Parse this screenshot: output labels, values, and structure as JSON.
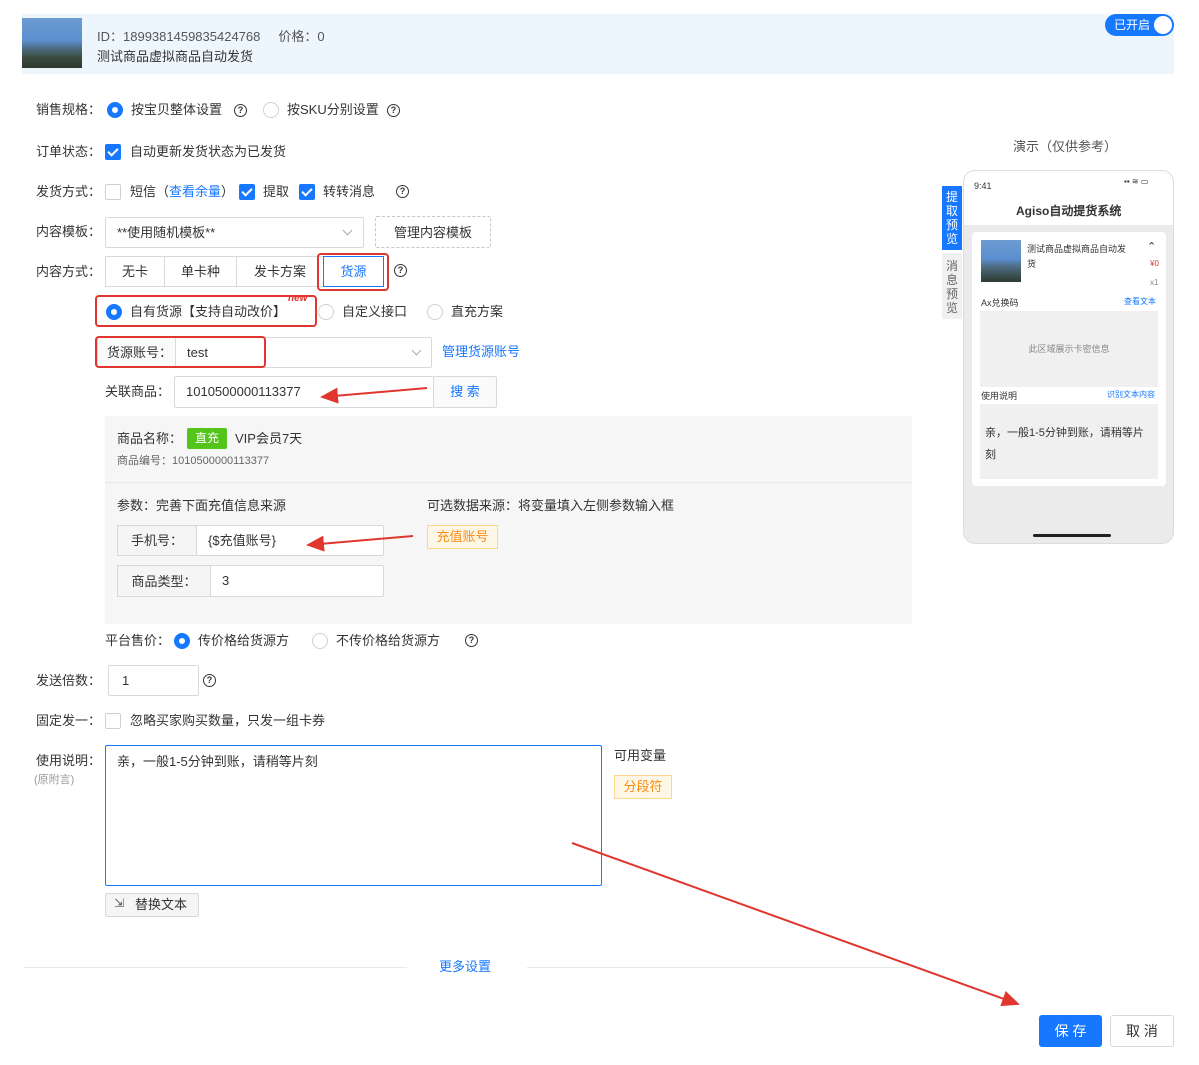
{
  "header": {
    "id_label": "ID：1899381459835424768",
    "price_label": "价格：0",
    "title": "测试商品虚拟商品自动发货",
    "status_toggle": "已开启"
  },
  "form": {
    "sales_spec": {
      "label": "销售规格：",
      "opt1": "按宝贝整体设置",
      "opt2": "按SKU分别设置"
    },
    "order_status": {
      "label": "订单状态：",
      "opt": "自动更新发货状态为已发货"
    },
    "ship_method": {
      "label": "发货方式：",
      "sms": "短信（",
      "check_balance": "查看余量",
      "sms_end": "）",
      "pickup": "提取",
      "forward": "转转消息"
    },
    "template": {
      "label": "内容模板：",
      "value": "**使用随机模板**",
      "manage": "管理内容模板"
    },
    "content_mode": {
      "label": "内容方式：",
      "tabs": [
        "无卡",
        "单卡种",
        "发卡方案",
        "货源"
      ]
    },
    "source_type": {
      "opt1": "自有货源【支持自动改价】",
      "new_badge": "new",
      "opt2": "自定义接口",
      "opt3": "直充方案"
    },
    "source_account": {
      "label": "货源账号：",
      "value": "test",
      "manage": "管理货源账号"
    },
    "related_product": {
      "label": "关联商品：",
      "value": "1010500000113377",
      "search": "搜 索"
    },
    "product_info": {
      "name_label": "商品名称：",
      "badge": "直充",
      "name": "VIP会员7天",
      "code": "商品编号：1010500000113377"
    },
    "params": {
      "title": "参数：完善下面充值信息来源",
      "source_hint": "可选数据来源：将变量填入左侧参数输入框",
      "phone_label": "手机号：",
      "phone_value": "{$充值账号}",
      "type_label": "商品类型：",
      "type_value": "3",
      "tag": "充值账号"
    },
    "platform_price": {
      "label": "平台售价：",
      "opt1": "传价格给货源方",
      "opt2": "不传价格给货源方"
    },
    "send_times": {
      "label": "发送倍数：",
      "value": "1"
    },
    "fixed_one": {
      "label": "固定发一：",
      "opt": "忽略买家购买数量，只发一组卡券"
    },
    "instructions": {
      "label": "使用说明：",
      "sublabel": "(原附言)",
      "value": "亲，一般1-5分钟到账，请稍等片刻",
      "vars_label": "可用变量",
      "tag": "分段符",
      "replace": "替换文本"
    },
    "more_settings": "更多设置",
    "save": "保 存",
    "cancel": "取 消"
  },
  "preview": {
    "title": "演示（仅供参考）",
    "tab1": "提取预览",
    "tab2": "消息预览",
    "time": "9:41",
    "app_title": "Agiso自动提货系统",
    "product_name": "测试商品虚拟商品自动发货",
    "price": "¥0",
    "qty": "x1",
    "ax_label": "Ax兑换码",
    "view_text": "查看文本",
    "card_area": "此区域展示卡密信息",
    "usage_label": "使用说明",
    "recognize": "识别文本内容",
    "usage_text": "亲，一般1-5分钟到账，请稍等片刻"
  }
}
